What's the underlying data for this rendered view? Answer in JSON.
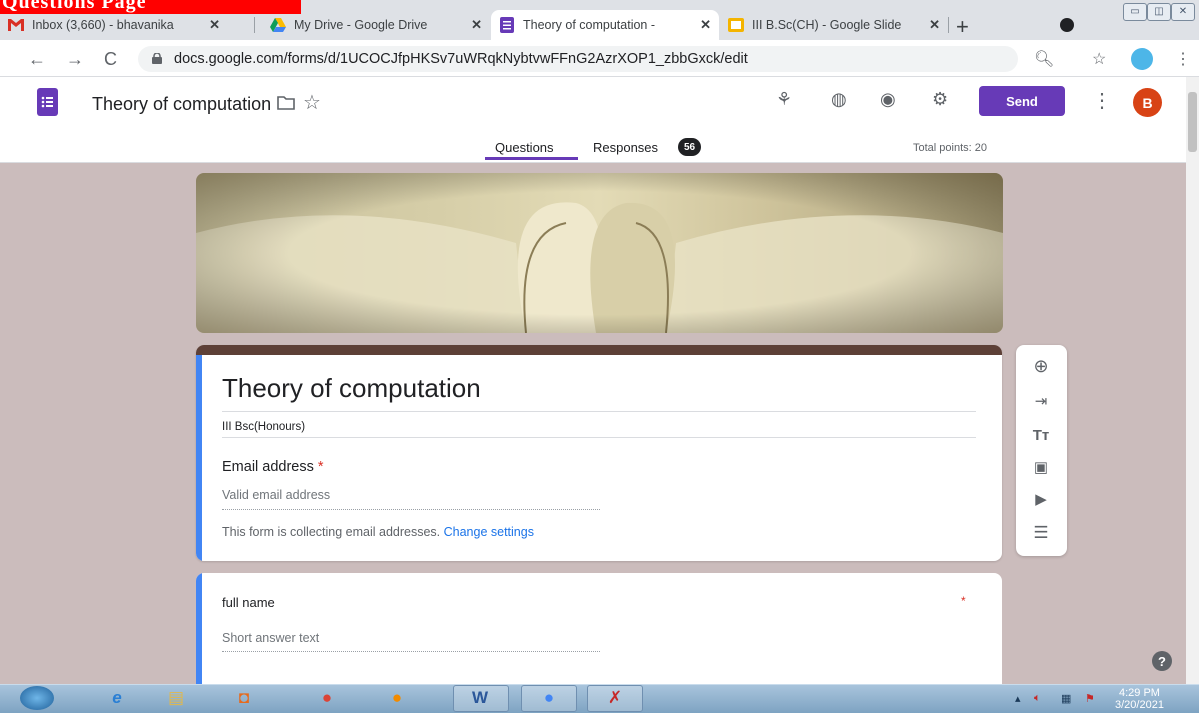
{
  "browser": {
    "tabs": [
      {
        "title": "Inbox (3,660) - bhavanika",
        "icon": "gmail-icon",
        "close": "✕"
      },
      {
        "title": "My Drive - Google Drive",
        "icon": "google-drive-icon",
        "close": "✕"
      },
      {
        "title": "Theory of computation -",
        "icon": "google-forms-icon",
        "close": "✕"
      },
      {
        "title": "III B.Sc(CH) - Google Slide",
        "icon": "google-slides-icon",
        "close": "✕"
      }
    ],
    "new_tab": "+",
    "url": "docs.google.com/forms/d/1UCOCJfpHKSv7uWRqkNybtvwFFnG2AzrXOP1_zbbGxck/edit",
    "window_buttons": [
      "▭",
      "◫",
      "✕"
    ]
  },
  "overlay_banner": "Questions Page",
  "forms_header": {
    "title": "Theory of computation",
    "send_label": "Send",
    "avatar_letter": "B",
    "tabs": {
      "questions": "Questions",
      "responses": "Responses"
    },
    "responses_count": "56",
    "total_points": "Total points: 20",
    "accent_color": "#673ab7"
  },
  "form": {
    "title": "Theory of computation",
    "description": "III Bsc(Honours)",
    "email_label": "Email address",
    "required_mark": "*",
    "email_placeholder": "Valid email address",
    "collecting_note": "This form is collecting email addresses.",
    "change_settings": "Change settings",
    "theme_color": "#5d4037"
  },
  "question": {
    "title": "full name",
    "required_mark": "*",
    "placeholder": "Short answer text"
  },
  "side_toolbar": [
    "add-question-icon",
    "import-questions-icon",
    "add-title-icon",
    "add-image-icon",
    "add-video-icon",
    "add-section-icon"
  ],
  "taskbar": {
    "time": "4:29 PM",
    "date": "3/20/2021"
  }
}
